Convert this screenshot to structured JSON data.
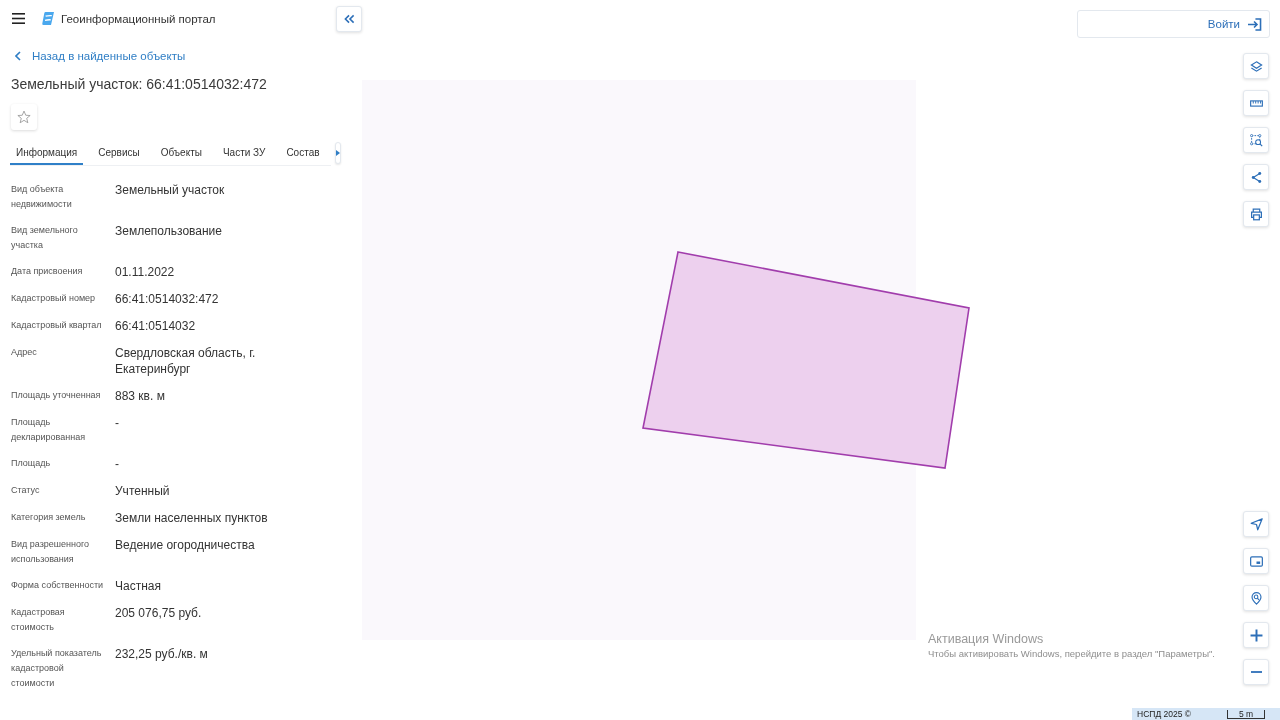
{
  "header": {
    "title": "Геоинформационный портал"
  },
  "back_link": {
    "label": "Назад в найденные объекты"
  },
  "object": {
    "title": "Земельный участок: 66:41:0514032:472",
    "favorite": false
  },
  "tabs": [
    {
      "label": "Информация",
      "selected": true
    },
    {
      "label": "Сервисы",
      "selected": false
    },
    {
      "label": "Объекты",
      "selected": false
    },
    {
      "label": "Части ЗУ",
      "selected": false
    },
    {
      "label": "Состав",
      "selected": false
    }
  ],
  "properties": [
    {
      "label": "Вид объекта недвижимости",
      "value": "Земельный участок"
    },
    {
      "label": "Вид земельного участка",
      "value": "Землепользование"
    },
    {
      "label": "Дата присвоения",
      "value": "01.11.2022"
    },
    {
      "label": "Кадастровый номер",
      "value": "66:41:0514032:472"
    },
    {
      "label": "Кадастровый квартал",
      "value": "66:41:0514032"
    },
    {
      "label": "Адрес",
      "value": "Свердловская область, г. Екатеринбург"
    },
    {
      "label": "Площадь уточненная",
      "value": "883 кв. м"
    },
    {
      "label": "Площадь декларированная",
      "value": "-"
    },
    {
      "label": "Площадь",
      "value": "-"
    },
    {
      "label": "Статус",
      "value": "Учтенный"
    },
    {
      "label": "Категория земель",
      "value": "Земли населенных пунктов"
    },
    {
      "label": "Вид разрешенного использования",
      "value": "Ведение огородничества"
    },
    {
      "label": "Форма собственности",
      "value": "Частная"
    },
    {
      "label": "Кадастровая стоимость",
      "value": "205 076,75 руб."
    },
    {
      "label": "Удельный показатель кадастровой стоимости",
      "value": "232,25 руб./кв. м"
    }
  ],
  "login_button": {
    "label": "Войти"
  },
  "footer": {
    "attribution": "НСПД 2025 ©",
    "scale": "5 m"
  },
  "windows_activation": {
    "title": "Активация Windows",
    "message": "Чтобы активировать Windows, перейдите в раздел \"Параметры\"."
  }
}
